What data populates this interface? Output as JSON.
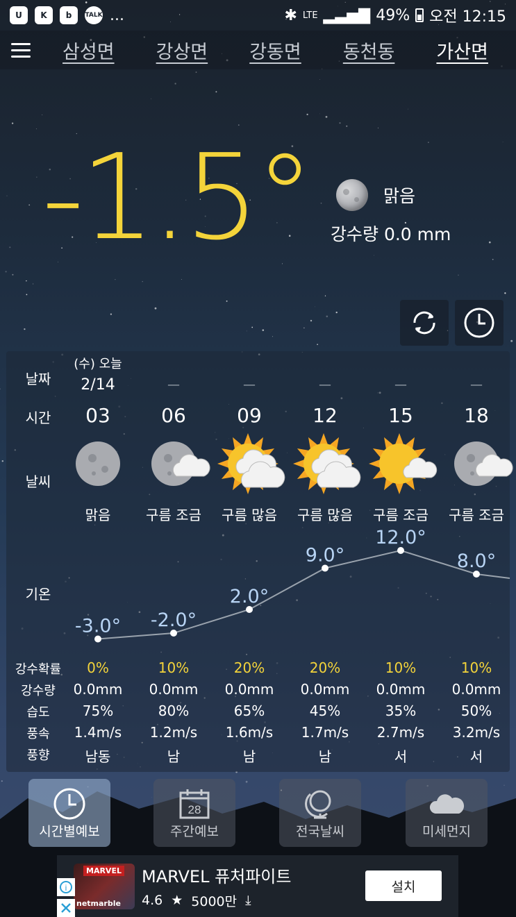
{
  "status_bar": {
    "battery": "49%",
    "time": "오전 12:15",
    "network": "LTE",
    "app_icons": [
      "app-icon-u",
      "app-icon-k",
      "app-icon-b",
      "talk-icon"
    ],
    "more": "..."
  },
  "tabs": [
    {
      "label": "삼성면",
      "active": false
    },
    {
      "label": "강상면",
      "active": false
    },
    {
      "label": "강동면",
      "active": false
    },
    {
      "label": "동천동",
      "active": false
    },
    {
      "label": "가산면",
      "active": true
    }
  ],
  "current": {
    "temperature": "-1.5°",
    "condition": "맑음",
    "precipitation": "강수량 0.0 mm"
  },
  "labels": {
    "date": "날짜",
    "time": "시간",
    "weather": "날씨",
    "temperature": "기온",
    "precip_prob": "강수확률",
    "precip_amount": "강수량",
    "humidity": "습도",
    "wind_speed": "풍속",
    "wind_dir": "풍향"
  },
  "date": {
    "day": "(수) 오늘",
    "date": "2/14",
    "dash": "—"
  },
  "hours": [
    {
      "time": "03",
      "cond": "맑음",
      "icon": "moon",
      "temp": "-3.0°",
      "prob": "0%",
      "amount": "0.0mm",
      "humidity": "75%",
      "wind": "1.4m/s",
      "dir": "남동"
    },
    {
      "time": "06",
      "cond": "구름 조금",
      "icon": "moon-cloud",
      "temp": "-2.0°",
      "prob": "10%",
      "amount": "0.0mm",
      "humidity": "80%",
      "wind": "1.2m/s",
      "dir": "남"
    },
    {
      "time": "09",
      "cond": "구름 많음",
      "icon": "sun-clouds",
      "temp": "2.0°",
      "prob": "20%",
      "amount": "0.0mm",
      "humidity": "65%",
      "wind": "1.6m/s",
      "dir": "남"
    },
    {
      "time": "12",
      "cond": "구름 많음",
      "icon": "sun-clouds",
      "temp": "9.0°",
      "prob": "20%",
      "amount": "0.0mm",
      "humidity": "45%",
      "wind": "1.7m/s",
      "dir": "남"
    },
    {
      "time": "15",
      "cond": "구름 조금",
      "icon": "sun-cloud",
      "temp": "12.0°",
      "prob": "10%",
      "amount": "0.0mm",
      "humidity": "35%",
      "wind": "2.7m/s",
      "dir": "서"
    },
    {
      "time": "18",
      "cond": "구름 조금",
      "icon": "moon-cloud",
      "temp": "8.0°",
      "prob": "10%",
      "amount": "0.0mm",
      "humidity": "50%",
      "wind": "3.2m/s",
      "dir": "서"
    }
  ],
  "chart_data": {
    "type": "line",
    "x": [
      "03",
      "06",
      "09",
      "12",
      "15",
      "18"
    ],
    "values": [
      -3.0,
      -2.0,
      2.0,
      9.0,
      12.0,
      8.0
    ],
    "ylim": [
      -6,
      14
    ]
  },
  "bottom_nav": [
    {
      "label": "시간별예보",
      "icon": "clock-icon",
      "active": true
    },
    {
      "label": "주간예보",
      "icon": "calendar-icon",
      "active": false,
      "calendar_day": "28"
    },
    {
      "label": "전국날씨",
      "icon": "globe-icon",
      "active": false
    },
    {
      "label": "미세먼지",
      "icon": "cloud-icon",
      "active": false
    }
  ],
  "ad": {
    "title": "MARVEL 퓨처파이트",
    "rating": "4.6",
    "downloads": "5000만",
    "install": "설치",
    "thumb_brand": "MARVEL",
    "thumb_publisher": "netmarble"
  },
  "colors": {
    "accent_temp": "#f4d43a",
    "temp_label": "#b8d4f4",
    "prob_yellow": "#f4d43a"
  }
}
